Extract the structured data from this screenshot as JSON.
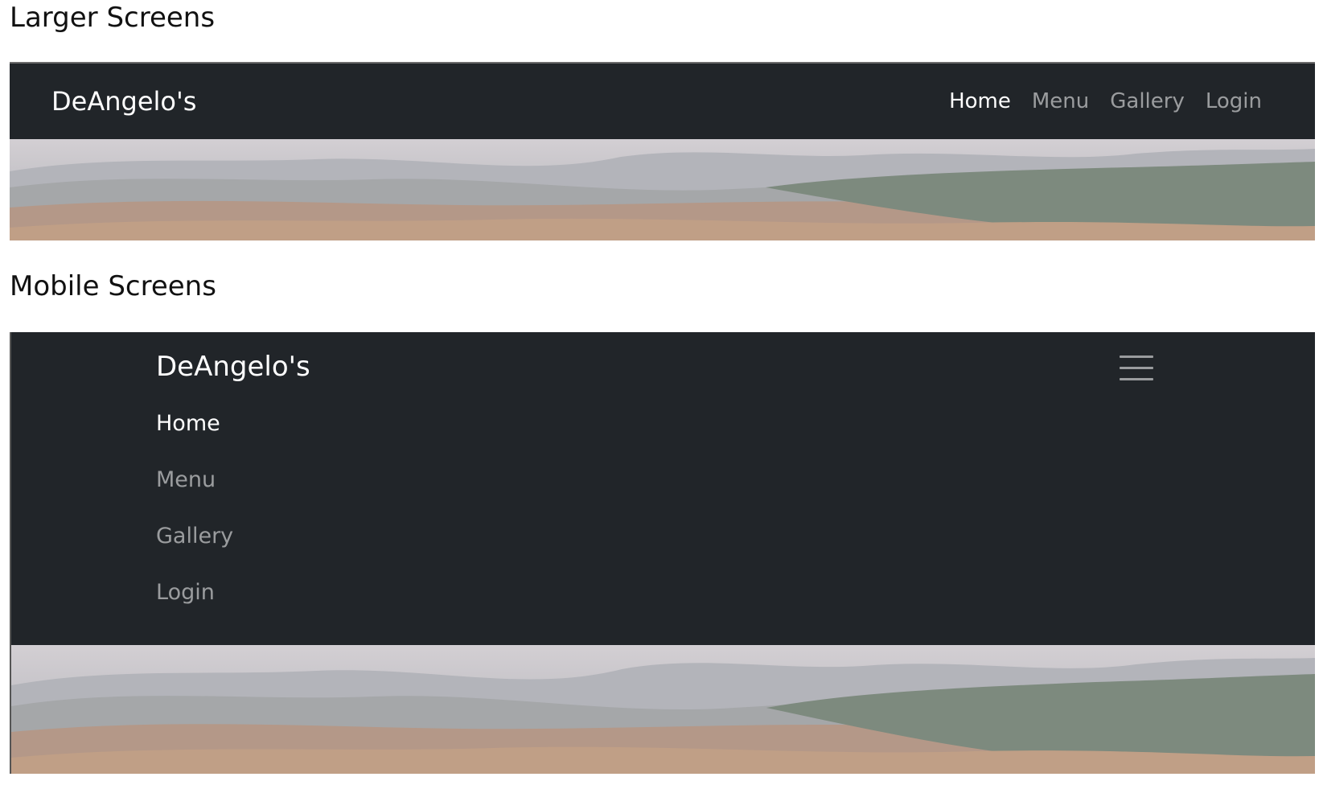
{
  "sections": {
    "large_title": "Larger Screens",
    "mobile_title": "Mobile Screens"
  },
  "large": {
    "brand": "DeAngelo's",
    "nav": [
      {
        "label": "Home",
        "active": true
      },
      {
        "label": "Menu",
        "active": false
      },
      {
        "label": "Gallery",
        "active": false
      },
      {
        "label": "Login",
        "active": false
      }
    ]
  },
  "mobile": {
    "brand": "DeAngelo's",
    "toggler_icon": "hamburger-menu-icon",
    "nav": [
      {
        "label": "Home",
        "active": true
      },
      {
        "label": "Menu",
        "active": false
      },
      {
        "label": "Gallery",
        "active": false
      },
      {
        "label": "Login",
        "active": false
      }
    ]
  },
  "colors": {
    "navbar_bg": "#212529",
    "nav_active": "#ffffff",
    "nav_inactive": "rgba(255,255,255,0.55)"
  }
}
